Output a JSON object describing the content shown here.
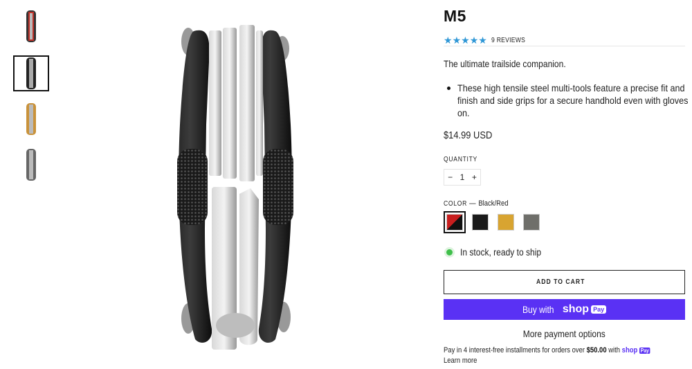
{
  "product": {
    "title": "M5",
    "rating_stars": 5,
    "reviews": "9 REVIEWS",
    "tagline": "The ultimate trailside companion.",
    "bullets": [
      "These high tensile steel multi-tools feature a precise fit and finish and side grips for a secure handhold even with gloves on."
    ],
    "price": "$14.99 USD"
  },
  "quantity": {
    "label": "QUANTITY",
    "minus": "−",
    "value": "1",
    "plus": "+"
  },
  "color": {
    "label": "COLOR",
    "separator": "—",
    "selected": "Black/Red",
    "swatches": [
      {
        "name": "Black/Red",
        "colors": [
          "#c81e1e",
          "#111111"
        ]
      },
      {
        "name": "Black",
        "colors": [
          "#1a1a1a"
        ]
      },
      {
        "name": "Gold",
        "colors": [
          "#d8a431"
        ]
      },
      {
        "name": "Grey",
        "colors": [
          "#6f6f6a"
        ]
      }
    ]
  },
  "stock": "In stock, ready to ship",
  "buttons": {
    "add_to_cart": "ADD TO CART",
    "buy_with": "Buy with",
    "shop_logo": "shop",
    "pay_badge": "Pay",
    "more_payment": "More payment options"
  },
  "installments": {
    "prefix": "Pay in 4 interest-free installments for orders over",
    "amount": "$50.00",
    "suffix": "with",
    "logo": "shop",
    "badge": "Pay",
    "learn_more": "Learn more"
  },
  "thumbnails": [
    {
      "name": "red",
      "accent": "#c0322a"
    },
    {
      "name": "black",
      "accent": "#222222"
    },
    {
      "name": "gold",
      "accent": "#c9923a"
    },
    {
      "name": "grey",
      "accent": "#777777"
    }
  ],
  "colors": {
    "accent_star": "#2f97d6",
    "shop_pay": "#5a31f4",
    "in_stock": "#3fbf4a"
  }
}
